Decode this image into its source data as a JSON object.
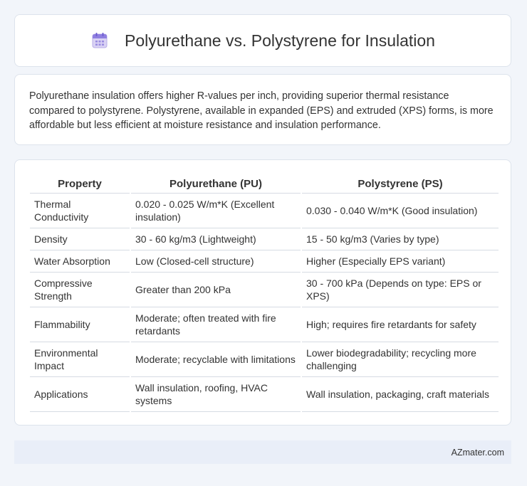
{
  "header": {
    "title": "Polyurethane vs. Polystyrene for Insulation",
    "icon": "calendar-icon"
  },
  "intro": {
    "text": "Polyurethane insulation offers higher R-values per inch, providing superior thermal resistance compared to polystyrene. Polystyrene, available in expanded (EPS) and extruded (XPS) forms, is more affordable but less efficient at moisture resistance and insulation performance."
  },
  "table": {
    "headers": [
      "Property",
      "Polyurethane (PU)",
      "Polystyrene (PS)"
    ],
    "rows": [
      [
        "Thermal Conductivity",
        "0.020 - 0.025 W/m*K (Excellent insulation)",
        "0.030 - 0.040 W/m*K (Good insulation)"
      ],
      [
        "Density",
        "30 - 60 kg/m3 (Lightweight)",
        "15 - 50 kg/m3 (Varies by type)"
      ],
      [
        "Water Absorption",
        "Low (Closed-cell structure)",
        "Higher (Especially EPS variant)"
      ],
      [
        "Compressive Strength",
        "Greater than 200 kPa",
        "30 - 700 kPa (Depends on type: EPS or XPS)"
      ],
      [
        "Flammability",
        "Moderate; often treated with fire retardants",
        "High; requires fire retardants for safety"
      ],
      [
        "Environmental Impact",
        "Moderate; recyclable with limitations",
        "Lower biodegradability; recycling more challenging"
      ],
      [
        "Applications",
        "Wall insulation, roofing, HVAC systems",
        "Wall insulation, packaging, craft materials"
      ]
    ]
  },
  "footer": {
    "brand": "AZmater.com"
  }
}
